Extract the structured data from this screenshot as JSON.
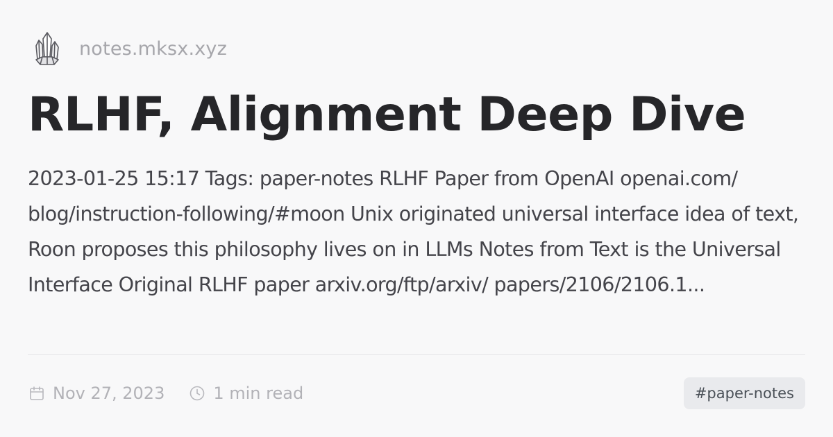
{
  "site": {
    "name": "notes.mksx.xyz",
    "logo_icon": "crystal-cluster-icon"
  },
  "post": {
    "title": "RLHF, Alignment Deep Dive",
    "description": "2023-01-25 15:17 Tags: paper-notes RLHF Paper from OpenAI openai.com/ blog/instruction-following/#moon Unix originated universal interface idea of text, Roon proposes this philosophy lives on in LLMs Notes from Text is the Universal Interface Original RLHF paper arxiv.org/ftp/arxiv/ papers/2106/2106.1..."
  },
  "meta": {
    "date": "Nov 27, 2023",
    "date_icon": "calendar-icon",
    "read_time": "1 min read",
    "read_time_icon": "clock-icon"
  },
  "tags": [
    {
      "label": "#paper-notes"
    }
  ],
  "colors": {
    "background": "#f8f8f9",
    "title": "#262629",
    "body_text": "#44444a",
    "muted": "#a6a6ab",
    "tag_bg": "#e9eaed",
    "tag_text": "#4a5057"
  }
}
